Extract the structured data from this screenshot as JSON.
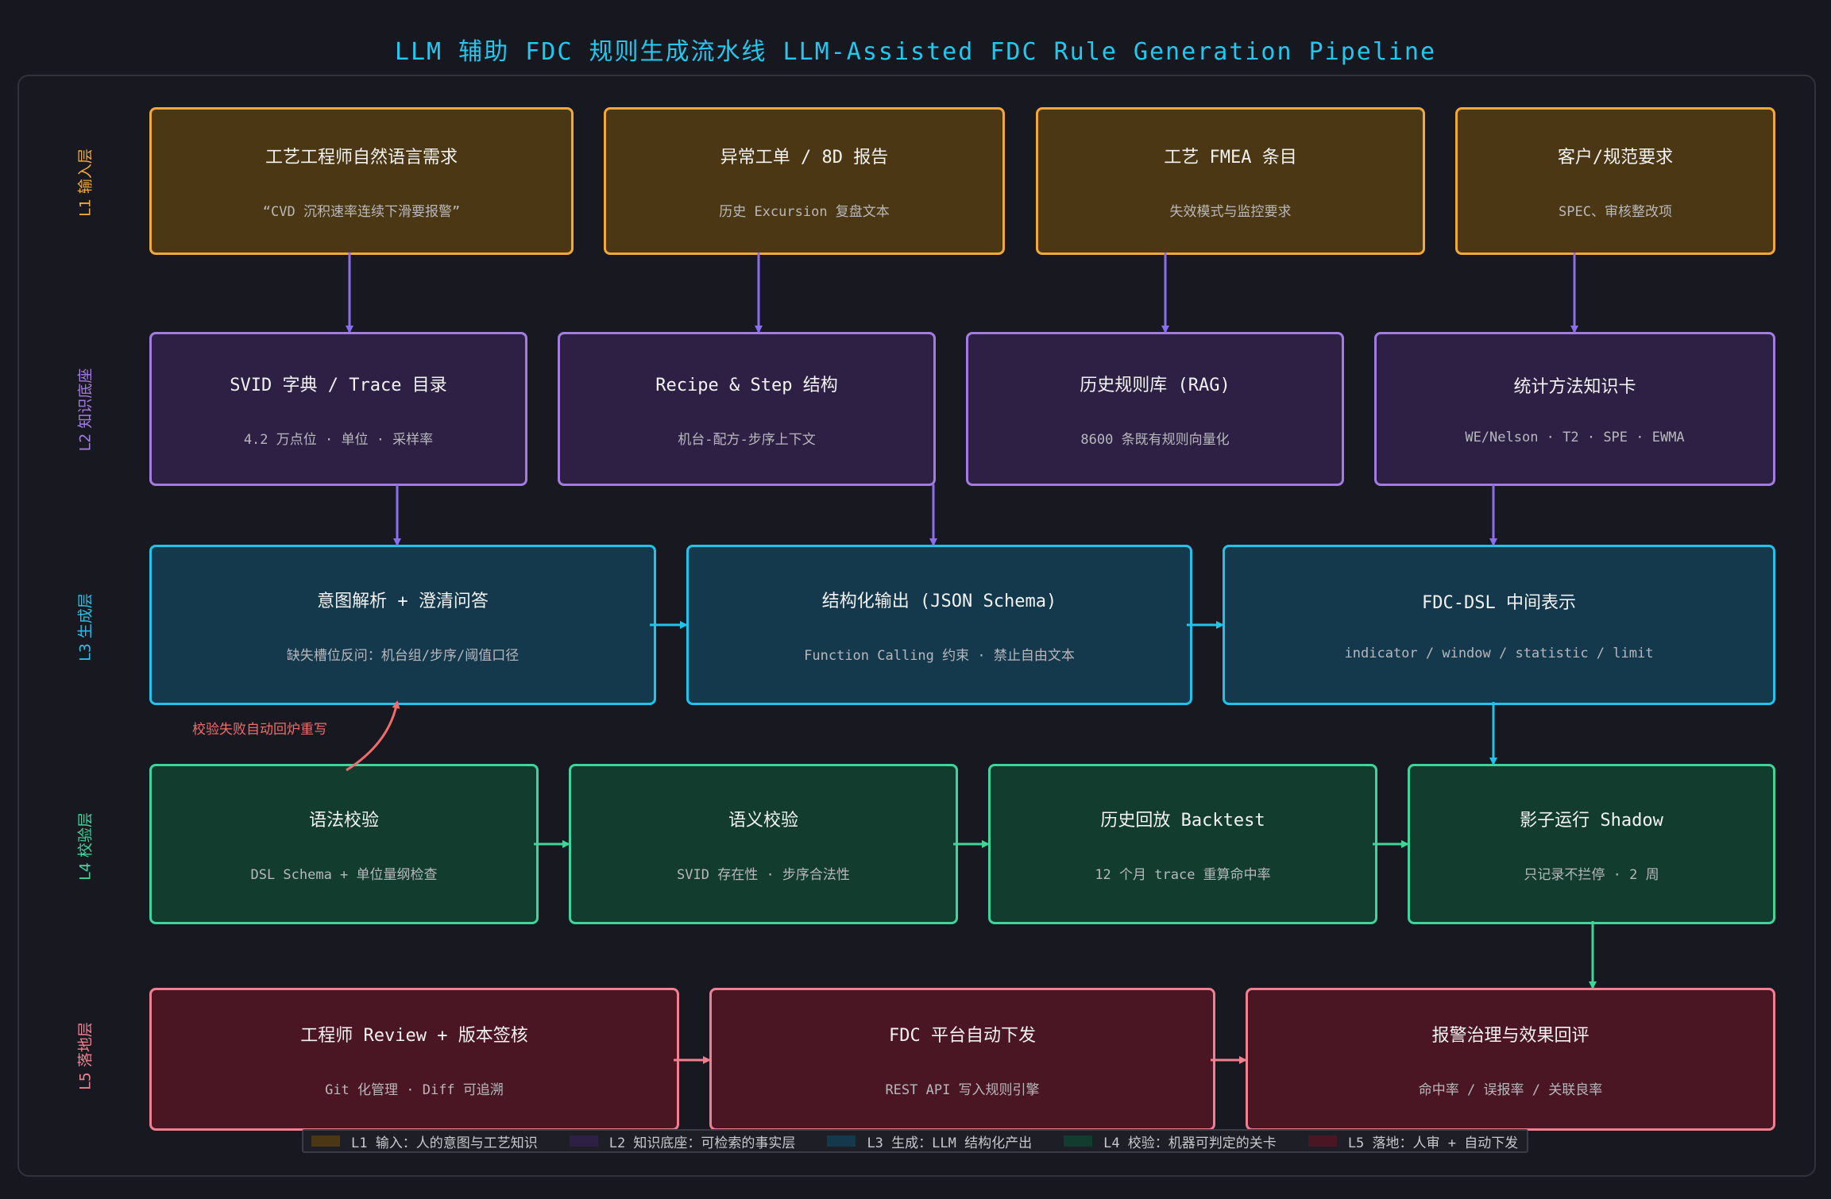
{
  "title": "LLM 辅助 FDC 规则生成流水线  LLM-Assisted FDC Rule Generation Pipeline",
  "colors": {
    "l1_border": "#f0a83a",
    "l1_fill": "#4b3713",
    "l2_border": "#a27ce0",
    "l2_fill": "#2d2044",
    "l3_border": "#22c3ea",
    "l3_fill": "#14384c",
    "l4_border": "#3fd49a",
    "l4_fill": "#123d2e",
    "l5_border": "#f0808f",
    "l5_fill": "#4a1624",
    "retry": "#f06c6c"
  },
  "layers": [
    {
      "label": "L1 输入层"
    },
    {
      "label": "L2 知识底座"
    },
    {
      "label": "L3 生成层"
    },
    {
      "label": "L4 校验层"
    },
    {
      "label": "L5 落地层"
    }
  ],
  "l1": [
    {
      "title": "工艺工程师自然语言需求",
      "sub": "“CVD 沉积速率连续下滑要报警”"
    },
    {
      "title": "异常工单 / 8D 报告",
      "sub": "历史 Excursion 复盘文本"
    },
    {
      "title": "工艺 FMEA 条目",
      "sub": "失效模式与监控要求"
    },
    {
      "title": "客户/规范要求",
      "sub": "SPEC、审核整改项"
    }
  ],
  "l2": [
    {
      "title": "SVID 字典 / Trace 目录",
      "sub": "4.2 万点位 · 单位 · 采样率"
    },
    {
      "title": "Recipe & Step 结构",
      "sub": "机台-配方-步序上下文"
    },
    {
      "title": "历史规则库 (RAG)",
      "sub": "8600 条既有规则向量化"
    },
    {
      "title": "统计方法知识卡",
      "sub": "WE/Nelson · T2 · SPE · EWMA"
    }
  ],
  "l3": [
    {
      "title": "意图解析 + 澄清问答",
      "sub": "缺失槽位反问：机台组/步序/阈值口径"
    },
    {
      "title": "结构化输出 (JSON Schema)",
      "sub": "Function Calling 约束 · 禁止自由文本"
    },
    {
      "title": "FDC-DSL 中间表示",
      "sub": "indicator / window / statistic / limit"
    }
  ],
  "l4": [
    {
      "title": "语法校验",
      "sub": "DSL Schema + 单位量纲检查"
    },
    {
      "title": "语义校验",
      "sub": "SVID 存在性 · 步序合法性"
    },
    {
      "title": "历史回放 Backtest",
      "sub": "12 个月 trace 重算命中率"
    },
    {
      "title": "影子运行 Shadow",
      "sub": "只记录不拦停 · 2 周"
    }
  ],
  "l5": [
    {
      "title": "工程师 Review + 版本签核",
      "sub": "Git 化管理 · Diff 可追溯"
    },
    {
      "title": "FDC 平台自动下发",
      "sub": "REST API 写入规则引擎"
    },
    {
      "title": "报警治理与效果回评",
      "sub": "命中率 / 误报率 / 关联良率"
    }
  ],
  "retry_label": "校验失败自动回炉重写",
  "legend": [
    {
      "text": "L1 输入：人的意图与工艺知识",
      "color": "#4b3713"
    },
    {
      "text": "L2 知识底座：可检索的事实层",
      "color": "#2d2044"
    },
    {
      "text": "L3 生成：LLM 结构化产出",
      "color": "#14384c"
    },
    {
      "text": "L4 校验：机器可判定的关卡",
      "color": "#123d2e"
    },
    {
      "text": "L5 落地：人审 + 自动下发",
      "color": "#4a1624"
    }
  ]
}
